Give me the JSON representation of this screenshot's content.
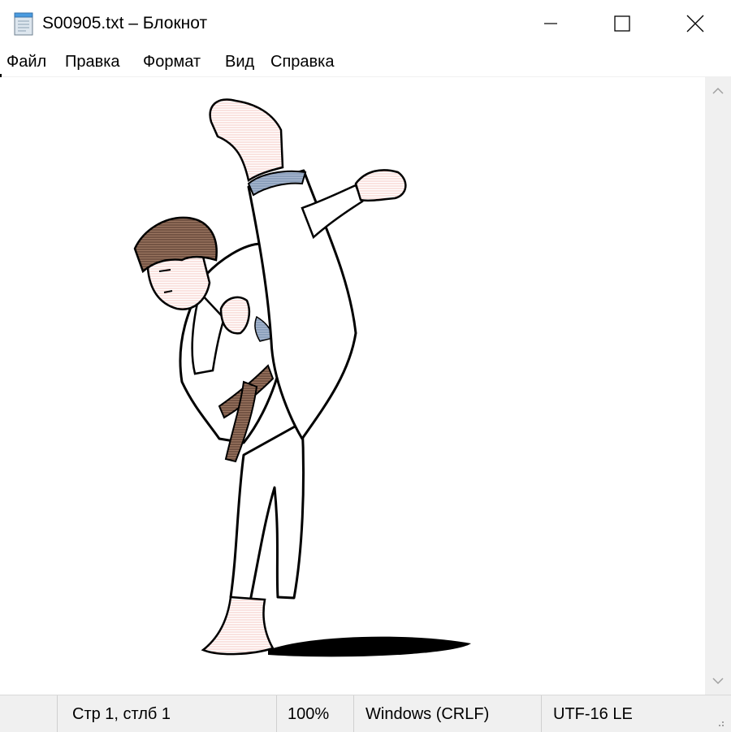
{
  "window": {
    "title": "S00905.txt – Блокнот",
    "app_icon": "notepad-icon",
    "controls": [
      "minimize-icon",
      "maximize-icon",
      "close-icon"
    ]
  },
  "menu": {
    "items": [
      {
        "label": "Файл"
      },
      {
        "label": "Правка"
      },
      {
        "label": "Формат"
      },
      {
        "label": "Вид"
      },
      {
        "label": "Справка"
      }
    ]
  },
  "editor": {
    "content_image": "karate-high-kick-figure"
  },
  "statusbar": {
    "position": "Стр 1, стлб 1",
    "zoom": "100%",
    "line_ending": "Windows (CRLF)",
    "encoding": "UTF-16 LE"
  },
  "colors": {
    "hair": "#7a5640",
    "belt": "#7a5640",
    "blue_undershirt": "#8fa3c0",
    "skin": "#fde9e6",
    "shadow": "#000000"
  }
}
